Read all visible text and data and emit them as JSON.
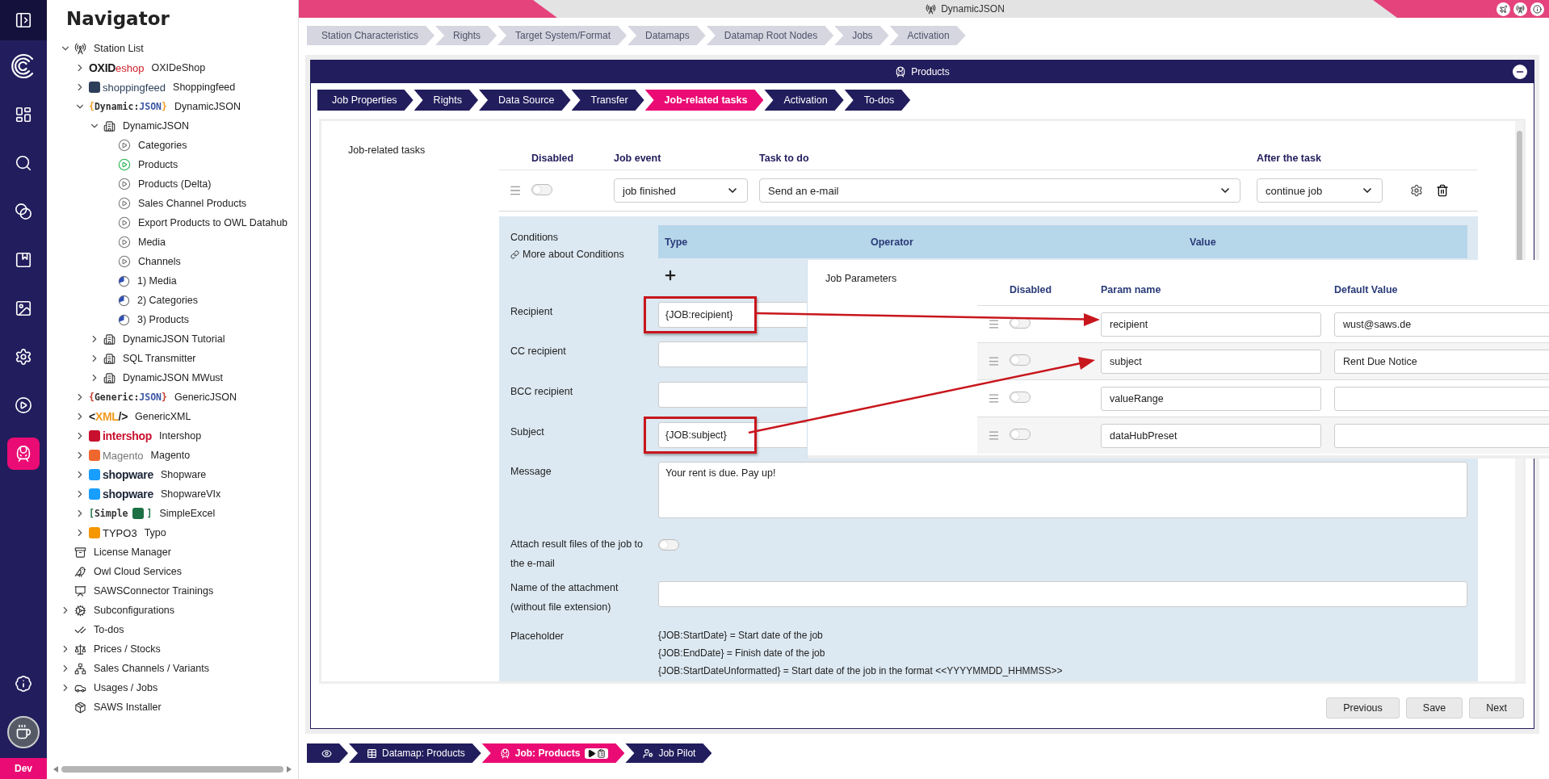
{
  "rail": {
    "items": [
      {
        "kind": "sidebar",
        "selected": false
      },
      {
        "kind": "brand",
        "selected": false
      },
      {
        "kind": "dashboard",
        "selected": false
      },
      {
        "kind": "search",
        "selected": false
      },
      {
        "kind": "connections",
        "selected": false
      },
      {
        "kind": "catalog",
        "selected": false
      },
      {
        "kind": "media",
        "selected": false
      },
      {
        "kind": "settings",
        "selected": false
      },
      {
        "kind": "run",
        "selected": false
      },
      {
        "kind": "jobs",
        "selected": true
      }
    ],
    "bottom_items": [
      {
        "kind": "info",
        "selected": false
      },
      {
        "kind": "avatar",
        "selected": false
      }
    ],
    "env_label": "Dev"
  },
  "navigator": {
    "title": "Navigator",
    "tree": [
      {
        "kind": "station-list",
        "label": "Station List",
        "expanded": true,
        "selected": false,
        "children": [
          {
            "kind": "shop",
            "label": "OXIDeShop",
            "expanded": false,
            "selected": false,
            "logo": [
              {
                "kind": "bold",
                "text": "OXID",
                "color": "#1a1a1a"
              },
              {
                "kind": "text",
                "text": "eshop",
                "color": "#d0202a"
              }
            ]
          },
          {
            "kind": "shop",
            "label": "Shoppingfeed",
            "expanded": false,
            "selected": false,
            "logo": [
              {
                "kind": "mark",
                "color": "#2d3e5a"
              },
              {
                "kind": "text",
                "text": "shoppingfeed",
                "color": "#2d3e5a"
              }
            ]
          },
          {
            "kind": "shop",
            "label": "DynamicJSON",
            "expanded": true,
            "selected": false,
            "logo": [
              {
                "kind": "code",
                "text": "{",
                "color": "#f29a1f"
              },
              {
                "kind": "code",
                "text": "Dynamic:",
                "color": "#333333"
              },
              {
                "kind": "code",
                "text": "JSON",
                "color": "#3a55a4"
              },
              {
                "kind": "code",
                "text": "}",
                "color": "#f29a1f"
              }
            ],
            "children": [
              {
                "kind": "station",
                "label": "DynamicJSON",
                "expanded": true,
                "selected": false,
                "children": [
                  {
                    "kind": "job",
                    "label": "Categories",
                    "selected": false
                  },
                  {
                    "kind": "job",
                    "label": "Products",
                    "selected": true
                  },
                  {
                    "kind": "job",
                    "label": "Products (Delta)",
                    "selected": false
                  },
                  {
                    "kind": "job",
                    "label": "Sales Channel Products",
                    "selected": false
                  },
                  {
                    "kind": "job",
                    "label": "Export Products to OWL Datahub",
                    "selected": false
                  },
                  {
                    "kind": "job",
                    "label": "Media",
                    "selected": false
                  },
                  {
                    "kind": "job",
                    "label": "Channels",
                    "selected": false
                  },
                  {
                    "kind": "sequence",
                    "label": "1) Media",
                    "selected": false
                  },
                  {
                    "kind": "sequence",
                    "label": "2) Categories",
                    "selected": false
                  },
                  {
                    "kind": "sequence",
                    "label": "3) Products",
                    "selected": false
                  }
                ]
              },
              {
                "kind": "station",
                "label": "DynamicJSON Tutorial",
                "expanded": false,
                "selected": false
              },
              {
                "kind": "station",
                "label": "SQL Transmitter",
                "expanded": false,
                "selected": false
              },
              {
                "kind": "station",
                "label": "DynamicJSON MWust",
                "expanded": false,
                "selected": false
              }
            ]
          },
          {
            "kind": "shop",
            "label": "GenericJSON",
            "expanded": false,
            "selected": false,
            "logo": [
              {
                "kind": "code",
                "text": "{",
                "color": "#c0392b"
              },
              {
                "kind": "code",
                "text": "Generic:",
                "color": "#333333"
              },
              {
                "kind": "code",
                "text": "JSON",
                "color": "#3a55a4"
              },
              {
                "kind": "code",
                "text": "}",
                "color": "#c0392b"
              }
            ]
          },
          {
            "kind": "shop",
            "label": "GenericXML",
            "expanded": false,
            "selected": false,
            "logo": [
              {
                "kind": "bold",
                "text": "<",
                "color": "#1a1a1a"
              },
              {
                "kind": "bold",
                "text": "XML",
                "color": "#f29a1f"
              },
              {
                "kind": "bold",
                "text": "/>",
                "color": "#1a1a1a"
              }
            ]
          },
          {
            "kind": "shop",
            "label": "Intershop",
            "expanded": false,
            "selected": false,
            "logo": [
              {
                "kind": "mark",
                "color": "#c8102e"
              },
              {
                "kind": "bold",
                "text": "intershop",
                "color": "#c8102e"
              }
            ]
          },
          {
            "kind": "shop",
            "label": "Magento",
            "expanded": false,
            "selected": false,
            "logo": [
              {
                "kind": "mark",
                "color": "#ee672f"
              },
              {
                "kind": "text",
                "text": "Magento",
                "color": "#777777"
              }
            ]
          },
          {
            "kind": "shop",
            "label": "Shopware",
            "expanded": false,
            "selected": false,
            "logo": [
              {
                "kind": "mark",
                "color": "#189eff"
              },
              {
                "kind": "bold",
                "text": "shopware",
                "color": "#1b2537"
              }
            ]
          },
          {
            "kind": "shop",
            "label": "ShopwareVIx",
            "expanded": false,
            "selected": false,
            "logo": [
              {
                "kind": "mark",
                "color": "#189eff"
              },
              {
                "kind": "bold",
                "text": "shopware",
                "color": "#1b2537"
              }
            ]
          },
          {
            "kind": "shop",
            "label": "SimpleExcel",
            "expanded": false,
            "selected": false,
            "logo": [
              {
                "kind": "code",
                "text": "[",
                "color": "#1d7044"
              },
              {
                "kind": "code",
                "text": "Simple",
                "color": "#333333"
              },
              {
                "kind": "mark",
                "color": "#1d7044"
              },
              {
                "kind": "code",
                "text": "]",
                "color": "#1d7044"
              }
            ]
          },
          {
            "kind": "shop",
            "label": "Typo",
            "expanded": false,
            "selected": false,
            "logo": [
              {
                "kind": "mark",
                "color": "#f49700"
              },
              {
                "kind": "text",
                "text": "TYPO3",
                "color": "#1a1a1a"
              }
            ]
          }
        ]
      },
      {
        "kind": "licenses",
        "label": "License Manager",
        "selected": false
      },
      {
        "kind": "cloud",
        "label": "Owl Cloud Services",
        "selected": false
      },
      {
        "kind": "trainings",
        "label": "SAWSConnector Trainings",
        "selected": false
      },
      {
        "kind": "subconfigurations",
        "label": "Subconfigurations",
        "expanded": false,
        "selected": false
      },
      {
        "kind": "todos",
        "label": "To-dos",
        "selected": false
      },
      {
        "kind": "prices",
        "label": "Prices / Stocks",
        "expanded": false,
        "selected": false
      },
      {
        "kind": "channels",
        "label": "Sales Channels / Variants",
        "expanded": false,
        "selected": false
      },
      {
        "kind": "usages",
        "label": "Usages / Jobs",
        "expanded": false,
        "selected": false
      },
      {
        "kind": "installer",
        "label": "SAWS Installer",
        "selected": false
      }
    ]
  },
  "header": {
    "title": "DynamicJSON"
  },
  "steps": [
    {
      "label": "Station Characteristics",
      "selected": false
    },
    {
      "label": "Rights",
      "selected": false
    },
    {
      "label": "Target System/Format",
      "selected": false
    },
    {
      "label": "Datamaps",
      "selected": false
    },
    {
      "label": "Datamap Root Nodes",
      "selected": false
    },
    {
      "label": "Jobs",
      "selected": false
    },
    {
      "label": "Activation",
      "selected": false
    }
  ],
  "card": {
    "title": "Products",
    "tabs": [
      {
        "label": "Job Properties",
        "selected": false
      },
      {
        "label": "Rights",
        "selected": false
      },
      {
        "label": "Data Source",
        "selected": false
      },
      {
        "label": "Transfer",
        "selected": false
      },
      {
        "label": "Job-related tasks",
        "selected": true
      },
      {
        "label": "Activation",
        "selected": false
      },
      {
        "label": "To-dos",
        "selected": false
      }
    ],
    "section_label": "Job-related tasks",
    "task_columns": [
      "Disabled",
      "Job event",
      "Task to do",
      "After the task"
    ],
    "tasks": [
      {
        "disabled": false,
        "job_event": "job finished",
        "task": "Send an e-mail",
        "after": "continue job",
        "conditions": {
          "label": "Conditions",
          "link": "More about Conditions",
          "columns": [
            "Type",
            "Operator",
            "Value"
          ]
        },
        "fields": [
          {
            "kind": "input",
            "label": "Recipient",
            "value": "{JOB:recipient}",
            "highlighted": true
          },
          {
            "kind": "input",
            "label": "CC recipient",
            "highlighted": false
          },
          {
            "kind": "input",
            "label": "BCC recipient",
            "highlighted": false
          },
          {
            "kind": "input",
            "label": "Subject",
            "value": "{JOB:subject}",
            "highlighted": true
          },
          {
            "kind": "textarea",
            "label": "Message",
            "value": "Your rent is due. Pay up!"
          },
          {
            "kind": "toggle",
            "label": "Attach result files of the job to the e-mail",
            "on": false
          },
          {
            "kind": "input",
            "label": "Name of the attachment (without file extension)",
            "highlighted": false
          },
          {
            "kind": "lines",
            "label": "Placeholder",
            "lines": [
              "{JOB:StartDate} = Start date of the job",
              "{JOB:EndDate} = Finish date of the job",
              "{JOB:StartDateUnformatted} = Start date of the job in the format <<YYYYMMDD_HHMMSS>>"
            ]
          }
        ]
      }
    ],
    "buttons": [
      "Previous",
      "Save",
      "Next"
    ]
  },
  "job_parameters": {
    "label": "Job Parameters",
    "columns": [
      "Disabled",
      "Param name",
      "Default Value"
    ],
    "rows": [
      {
        "disabled": false,
        "name": "recipient",
        "default": "wust@saws.de"
      },
      {
        "disabled": false,
        "name": "subject",
        "default": "Rent Due Notice"
      },
      {
        "disabled": false,
        "name": "valueRange"
      },
      {
        "disabled": false,
        "name": "dataHubPreset"
      }
    ]
  },
  "bottom_nav": [
    {
      "kind": "view",
      "selected": false
    },
    {
      "kind": "datamap",
      "label": "Datamap: Products",
      "selected": false
    },
    {
      "kind": "job",
      "label": "Job: Products",
      "selected": true
    },
    {
      "kind": "pilot",
      "label": "Job Pilot",
      "selected": false
    }
  ]
}
